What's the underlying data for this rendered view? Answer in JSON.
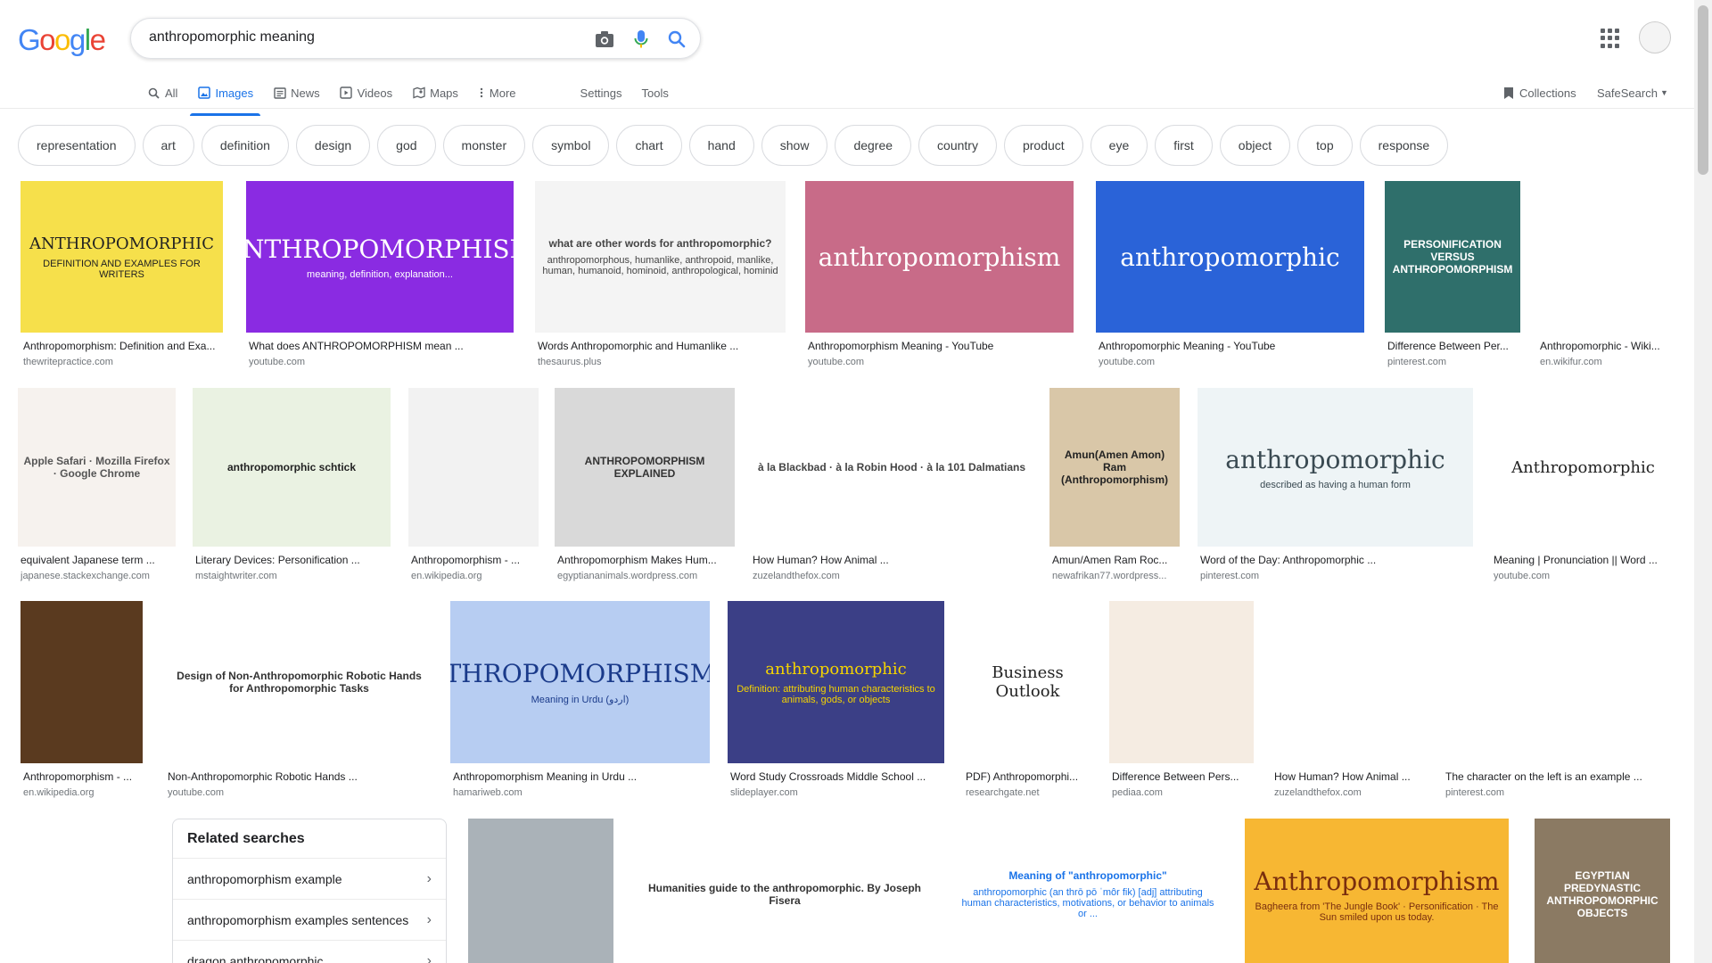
{
  "header": {
    "logo": [
      "G",
      "o",
      "o",
      "g",
      "l",
      "e"
    ],
    "logo_colors": [
      "#4285f4",
      "#ea4335",
      "#fbbc05",
      "#4285f4",
      "#34a853",
      "#ea4335"
    ],
    "query": "anthropomorphic meaning",
    "icons": {
      "camera": "camera-icon",
      "mic": "microphone-icon",
      "search": "search-icon",
      "apps": "apps-grid-icon"
    }
  },
  "tabs": {
    "all": "All",
    "images": "Images",
    "news": "News",
    "videos": "Videos",
    "maps": "Maps",
    "more": "More",
    "settings": "Settings",
    "tools": "Tools",
    "collections": "Collections",
    "safesearch": "SafeSearch"
  },
  "chips": [
    "representation",
    "art",
    "definition",
    "design",
    "god",
    "monster",
    "symbol",
    "chart",
    "hand",
    "show",
    "degree",
    "country",
    "product",
    "eye",
    "first",
    "object",
    "top",
    "response"
  ],
  "results": [
    {
      "caption": "Anthropomorphism: Definition and Exa...",
      "source": "thewritepractice.com",
      "text": "ANTHROPOMORPHIC",
      "sub": "DEFINITION AND EXAMPLES FOR WRITERS",
      "bg": "#f6e04b",
      "fg": "#222"
    },
    {
      "caption": "What does ANTHROPOMORPHISM mean ...",
      "source": "youtube.com",
      "text": "ANTHROPOMORPHISM",
      "sub": "meaning, definition, explanation...",
      "bg": "#8a2be2",
      "fg": "#fff"
    },
    {
      "caption": "Words Anthropomorphic and Humanlike ...",
      "source": "thesaurus.plus",
      "text": "what are other words for anthropomorphic?",
      "sub": "anthropomorphous, humanlike, anthropoid, manlike, human, humanoid, hominoid, anthropological, hominid",
      "bg": "#f4f4f4",
      "fg": "#444"
    },
    {
      "caption": "Anthropomorphism Meaning - YouTube",
      "source": "youtube.com",
      "text": "anthropomorphism",
      "sub": "",
      "bg": "#c86b88",
      "fg": "#fff"
    },
    {
      "caption": "Anthropomorphic Meaning - YouTube",
      "source": "youtube.com",
      "text": "anthropomorphic",
      "sub": "",
      "bg": "#2a63d8",
      "fg": "#fff"
    },
    {
      "caption": "Difference Between Per...",
      "source": "pinterest.com",
      "text": "PERSONIFICATION VERSUS ANTHROPOMORPHISM",
      "sub": "",
      "bg": "#2f6f6b",
      "fg": "#fff"
    },
    {
      "caption": "Anthropomorphic - Wiki...",
      "source": "en.wikifur.com",
      "text": "",
      "sub": "",
      "bg": "#ffffff",
      "fg": "#333"
    },
    {
      "caption": "equivalent Japanese term ...",
      "source": "japanese.stackexchange.com",
      "text": "Apple Safari · Mozilla Firefox · Google Chrome",
      "sub": "",
      "bg": "#f6f2ee",
      "fg": "#555"
    },
    {
      "caption": "Literary Devices: Personification ...",
      "source": "mstaightwriter.com",
      "text": "anthropomorphic schtick",
      "sub": "",
      "bg": "#eaf2e2",
      "fg": "#222"
    },
    {
      "caption": "Anthropomorphism - ...",
      "source": "en.wikipedia.org",
      "text": "",
      "sub": "",
      "bg": "#f2f2f2",
      "fg": "#222"
    },
    {
      "caption": "Anthropomorphism Makes Hum...",
      "source": "egyptiananimals.wordpress.com",
      "text": "ANTHROPOMORPHISM EXPLAINED",
      "sub": "",
      "bg": "#d9d9d9",
      "fg": "#333"
    },
    {
      "caption": "How Human? How Animal ...",
      "source": "zuzelandthefox.com",
      "text": "à la Blackbad · à la Robin Hood · à la 101 Dalmatians",
      "sub": "",
      "bg": "#ffffff",
      "fg": "#444"
    },
    {
      "caption": "Amun/Amen Ram Roc...",
      "source": "newafrikan77.wordpress...",
      "text": "Amun(Amen Amon) Ram (Anthropomorphism)",
      "sub": "",
      "bg": "#d9c7a8",
      "fg": "#222"
    },
    {
      "caption": "Word of the Day: Anthropomorphic ...",
      "source": "pinterest.com",
      "text": "anthropomorphic",
      "sub": "described as having a human form",
      "bg": "#eef4f6",
      "fg": "#3a4a52"
    },
    {
      "caption": "Meaning | Pronunciation || Word ...",
      "source": "youtube.com",
      "text": "Anthropomorphic",
      "sub": "",
      "bg": "#ffffff",
      "fg": "#222"
    },
    {
      "caption": "Anthropomorphism - ...",
      "source": "en.wikipedia.org",
      "text": "",
      "sub": "",
      "bg": "#5a3a1f",
      "fg": "#fff"
    },
    {
      "caption": "Non-Anthropomorphic Robotic Hands ...",
      "source": "youtube.com",
      "text": "Design of Non-Anthropomorphic Robotic Hands for Anthropomorphic Tasks",
      "sub": "",
      "bg": "#ffffff",
      "fg": "#333"
    },
    {
      "caption": "Anthropomorphism Meaning in Urdu ...",
      "source": "hamariweb.com",
      "text": "THROPOMORPHISM",
      "sub": "Meaning in Urdu (اردو)",
      "bg": "#b7cdf2",
      "fg": "#1a3a8a"
    },
    {
      "caption": "Word Study Crossroads Middle School ...",
      "source": "slideplayer.com",
      "text": "anthropomorphic",
      "sub": "Definition: attributing human characteristics to animals, gods, or objects",
      "bg": "#3b3f86",
      "fg": "#f5d400"
    },
    {
      "caption": "PDF) Anthropomorphi...",
      "source": "researchgate.net",
      "text": "Business Outlook",
      "sub": "",
      "bg": "#ffffff",
      "fg": "#222"
    },
    {
      "caption": "Difference Between Pers...",
      "source": "pediaa.com",
      "text": "",
      "sub": "",
      "bg": "#f5ece2",
      "fg": "#222"
    },
    {
      "caption": "How Human? How Animal ...",
      "source": "zuzelandthefox.com",
      "text": "",
      "sub": "",
      "bg": "#ffffff",
      "fg": "#222"
    },
    {
      "caption": "The character on the left is an example ...",
      "source": "pinterest.com",
      "text": "",
      "sub": "",
      "bg": "#ffffff",
      "fg": "#222"
    },
    {
      "caption": "",
      "source": "",
      "text": "",
      "sub": "",
      "bg": "#ffffff",
      "fg": "#222"
    },
    {
      "caption": "",
      "source": "",
      "text": "",
      "sub": "",
      "bg": "#aab2b8",
      "fg": "#222"
    },
    {
      "caption": "",
      "source": "",
      "text": "Humanities guide to the anthropomorphic. By Joseph Fisera",
      "sub": "",
      "bg": "#ffffff",
      "fg": "#333"
    },
    {
      "caption": "",
      "source": "",
      "text": "Meaning of \"anthropomorphic\"",
      "sub": "anthropomorphic (an thrō pō ˈmôr fik) [adj] attributing human characteristics, motivations, or behavior to animals or ...",
      "bg": "#ffffff",
      "fg": "#1a73e8"
    },
    {
      "caption": "",
      "source": "",
      "text": "Anthropomorphism",
      "sub": "Bagheera from 'The Jungle Book' · Personification · The Sun smiled upon us today.",
      "bg": "#f7b733",
      "fg": "#7a2e0e"
    },
    {
      "caption": "",
      "source": "",
      "text": "EGYPTIAN PREDYNASTIC ANTHROPOMORPHIC OBJECTS",
      "sub": "",
      "bg": "#8b7a63",
      "fg": "#fff"
    }
  ],
  "related": {
    "title": "Related searches",
    "items": [
      "anthropomorphism example",
      "anthropomorphism examples sentences",
      "dragon anthropomorphic"
    ]
  }
}
